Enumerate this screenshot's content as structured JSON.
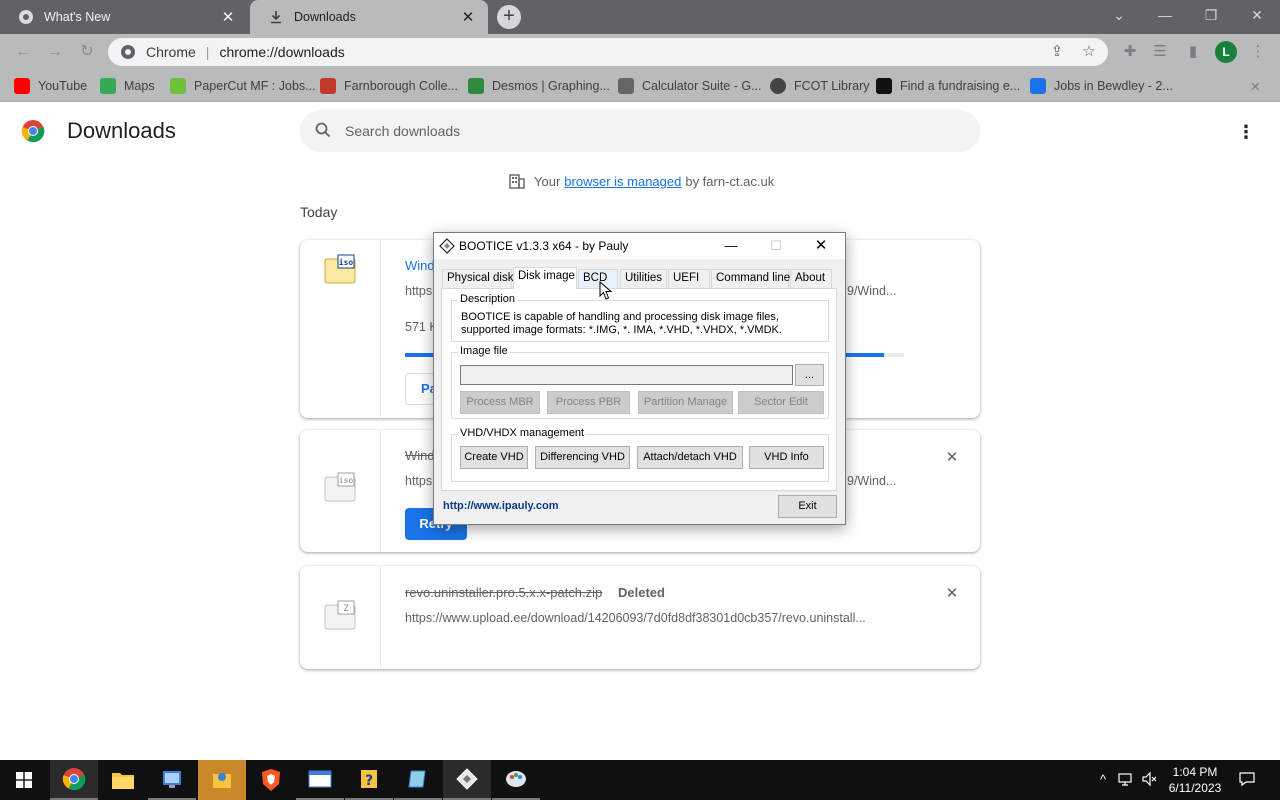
{
  "tabs": [
    {
      "title": "What's New"
    },
    {
      "title": "Downloads"
    }
  ],
  "omnibox": {
    "site_label": "Chrome",
    "url": "chrome://downloads"
  },
  "profile_initial": "L",
  "bookmarks": [
    {
      "label": "YouTube",
      "color": "#ff0000"
    },
    {
      "label": "Maps",
      "color": "#34a853"
    },
    {
      "label": "PaperCut MF : Jobs...",
      "color": "#6fbf3a"
    },
    {
      "label": "Farnborough Colle...",
      "color": "#c0392b"
    },
    {
      "label": "Desmos | Graphing...",
      "color": "#2e8b3e"
    },
    {
      "label": "Calculator Suite - G...",
      "color": "#666666"
    },
    {
      "label": "FCOT Library",
      "color": "#444444"
    },
    {
      "label": "Find a fundraising e...",
      "color": "#111111"
    },
    {
      "label": "Jobs in Bewdley - 2...",
      "color": "#1a73e8"
    }
  ],
  "page": {
    "title": "Downloads",
    "search_placeholder": "Search downloads",
    "managed": {
      "prefix": "Your",
      "link": "browser is managed",
      "suffix": "by farn-ct.ac.uk"
    },
    "section": "Today"
  },
  "downloads": [
    {
      "name": "Wind",
      "url": "https",
      "url_tail": "9/Wind...",
      "progress_text": "571 K",
      "progress": 0.96,
      "action": "Pa",
      "icon": "iso-file-icon"
    },
    {
      "name": "Wind",
      "url": "https",
      "url_tail": "9/Wind...",
      "action": "Retry",
      "icon": "iso-file-icon"
    },
    {
      "name": "revo.uninstaller.pro.5.x.x-patch.zip",
      "status": "Deleted",
      "url": "https://www.upload.ee/download/14206093/7d0fd8df38301d0cb357/revo.uninstall...",
      "icon": "zip-file-icon"
    }
  ],
  "dialog": {
    "title": "BOOTICE v1.3.3 x64 - by Pauly",
    "tabs": [
      "Physical disk",
      "Disk image",
      "BCD",
      "Utilities",
      "UEFI",
      "Command line",
      "About"
    ],
    "active_tab": "Disk image",
    "description_label": "Description",
    "description": "BOOTICE is capable of handling and processing disk image files, supported image formats: *.IMG, *. IMA, *.VHD, *.VHDX, *.VMDK.",
    "image_file_label": "Image file",
    "image_file_value": "",
    "browse": "...",
    "image_buttons": [
      "Process MBR",
      "Process PBR",
      "Partition Manage",
      "Sector Edit"
    ],
    "vhd_label": "VHD/VHDX management",
    "vhd_buttons": [
      "Create VHD",
      "Differencing VHD",
      "Attach/detach VHD",
      "VHD Info"
    ],
    "link": "http://www.ipauly.com",
    "exit": "Exit"
  },
  "taskbar": {
    "time": "1:04 PM",
    "date": "6/11/2023"
  }
}
